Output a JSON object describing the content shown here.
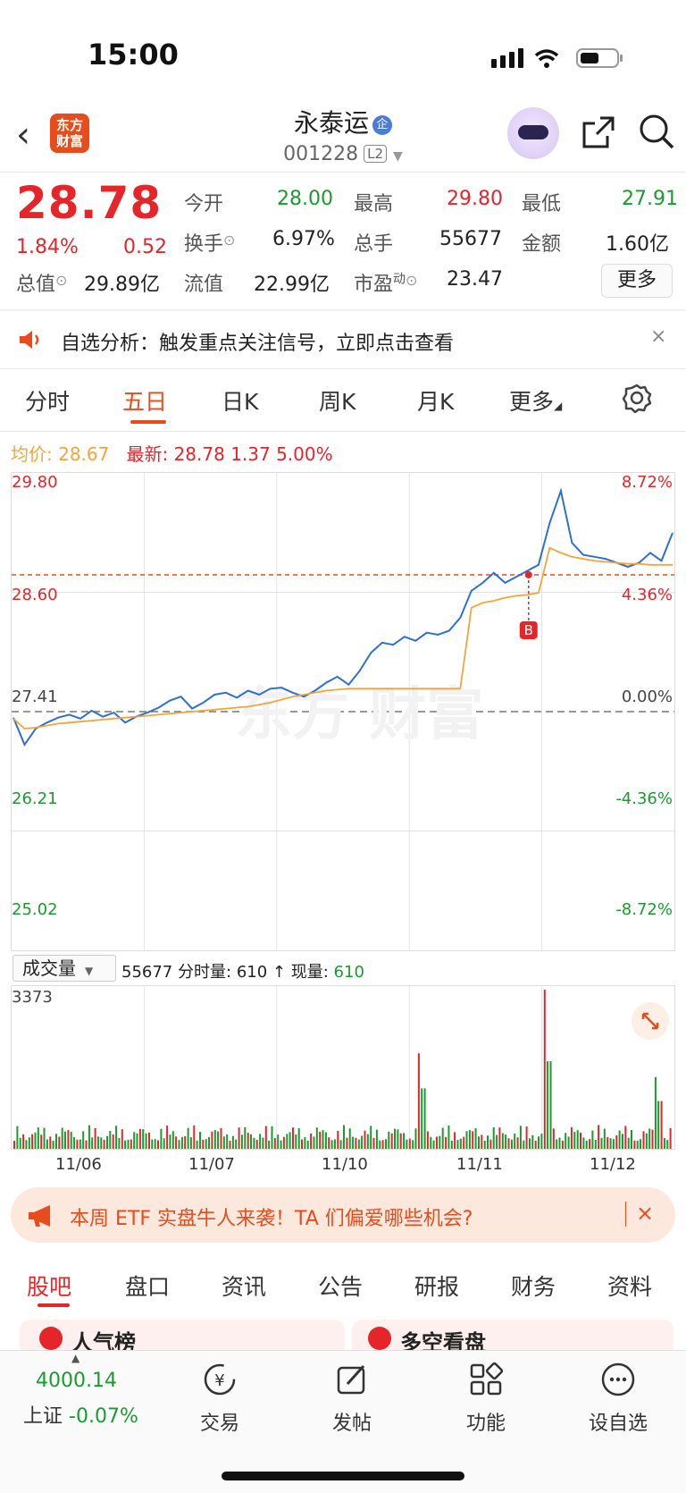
{
  "status": {
    "time": "15:00"
  },
  "header": {
    "logo_text": "东方\n财富",
    "stock_name": "永泰运",
    "badge": "企",
    "code": "001228",
    "level": "L2"
  },
  "quote": {
    "price": "28.78",
    "change_pct": "1.84%",
    "change_abs": "0.52",
    "fields": [
      {
        "label": "今开",
        "value": "28.00",
        "color": "green"
      },
      {
        "label": "最高",
        "value": "29.80",
        "color": "red"
      },
      {
        "label": "最低",
        "value": "27.91",
        "color": "green"
      },
      {
        "label": "换手",
        "value": "6.97%",
        "color": "black"
      },
      {
        "label": "总手",
        "value": "55677",
        "color": "black"
      },
      {
        "label": "金额",
        "value": "1.60亿",
        "color": "black"
      },
      {
        "label": "总值",
        "value": "29.89亿",
        "color": "black"
      },
      {
        "label": "流值",
        "value": "22.99亿",
        "color": "black"
      },
      {
        "label": "市盈",
        "value": "23.47",
        "color": "black"
      }
    ],
    "pe_sup": "动",
    "more_label": "更多"
  },
  "notice": {
    "text": "自选分析：触发重点关注信号，立即点击查看",
    "close": "×"
  },
  "tabs": [
    "分时",
    "五日",
    "日K",
    "周K",
    "月K",
    "更多"
  ],
  "active_tab": 1,
  "chart_stats": {
    "avg_label": "均价:",
    "avg_value": "28.67",
    "latest_label": "最新:",
    "latest_value": "28.78",
    "latest_change": "1.37",
    "latest_pct": "5.00%"
  },
  "chart_data": {
    "type": "line",
    "title": "",
    "x_labels": [
      "11/06",
      "11/07",
      "11/10",
      "11/11",
      "11/12"
    ],
    "y_labels_left": [
      "29.80",
      "28.60",
      "27.41",
      "26.21",
      "25.02"
    ],
    "y_labels_right": [
      "8.72%",
      "4.36%",
      "0.00%",
      "-4.36%",
      "-8.72%"
    ],
    "ylim": [
      25.02,
      29.8
    ],
    "prev_close": 27.41,
    "current": 28.78,
    "marker": "B",
    "series": [
      {
        "name": "",
        "color": "#2e6fd1",
        "values": [
          27.35,
          27.08,
          27.24,
          27.3,
          27.35,
          27.38,
          27.34,
          27.42,
          27.36,
          27.4,
          27.3,
          27.36,
          27.4,
          27.45,
          27.52,
          27.56,
          27.44,
          27.5,
          27.58,
          27.6,
          27.55,
          27.62,
          27.58,
          27.64,
          27.65,
          27.6,
          27.56,
          27.62,
          27.7,
          27.76,
          27.68,
          27.82,
          28.0,
          28.1,
          28.08,
          28.16,
          28.12,
          28.2,
          28.18,
          28.22,
          28.35,
          28.62,
          28.7,
          28.8,
          28.7,
          28.76,
          28.82,
          28.88,
          29.3,
          29.62,
          29.1,
          28.98,
          28.96,
          28.94,
          28.9,
          28.86,
          28.9,
          29.0,
          28.92,
          29.2
        ],
        "grid": true
      },
      {
        "name": "",
        "color": "#f2a53a",
        "values": [
          27.34,
          27.24,
          27.25,
          27.27,
          27.29,
          27.3,
          27.31,
          27.32,
          27.33,
          27.34,
          27.35,
          27.36,
          27.37,
          27.38,
          27.39,
          27.4,
          27.41,
          27.42,
          27.43,
          27.44,
          27.45,
          27.46,
          27.48,
          27.5,
          27.53,
          27.56,
          27.58,
          27.6,
          27.62,
          27.63,
          27.64,
          27.64,
          27.64,
          27.64,
          27.64,
          27.64,
          27.64,
          27.64,
          27.64,
          27.64,
          27.64,
          28.45,
          28.5,
          28.52,
          28.55,
          28.57,
          28.58,
          28.6,
          29.05,
          29.0,
          28.96,
          28.94,
          28.92,
          28.91,
          28.9,
          28.89,
          28.89,
          28.88,
          28.88,
          28.88
        ]
      }
    ],
    "volume": {
      "label": "成交量",
      "total": "55677",
      "tick_label": "分时量:",
      "tick_value": "610",
      "arrow": "↑",
      "now_label": "现量:",
      "now_value": "610",
      "max_label": "3373"
    }
  },
  "banner": {
    "text": "本周 ETF 实盘牛人来袭！TA 们偏爱哪些机会?",
    "close": "×"
  },
  "bottom_tabs": [
    "股吧",
    "盘口",
    "资讯",
    "公告",
    "研报",
    "财务",
    "资料"
  ],
  "bottom_active": 0,
  "cards": [
    "人气榜",
    "多空看盘"
  ],
  "footer": {
    "index_value": "4000.14",
    "index_name": "上证",
    "index_change": "-0.07%",
    "items": [
      {
        "label": "交易",
        "icon": "trade-icon"
      },
      {
        "label": "发帖",
        "icon": "post-icon"
      },
      {
        "label": "功能",
        "icon": "grid-icon"
      },
      {
        "label": "设自选",
        "icon": "add-watch-icon"
      }
    ]
  }
}
